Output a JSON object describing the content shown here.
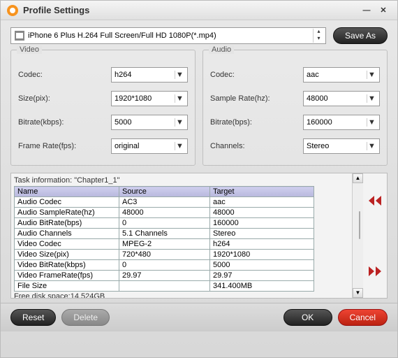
{
  "window": {
    "title": "Profile Settings"
  },
  "profile": {
    "selected": "iPhone 6 Plus H.264 Full Screen/Full HD 1080P(*.mp4)",
    "save_as": "Save As"
  },
  "video": {
    "legend": "Video",
    "codec_label": "Codec:",
    "codec": "h264",
    "size_label": "Size(pix):",
    "size": "1920*1080",
    "bitrate_label": "Bitrate(kbps):",
    "bitrate": "5000",
    "fps_label": "Frame Rate(fps):",
    "fps": "original"
  },
  "audio": {
    "legend": "Audio",
    "codec_label": "Codec:",
    "codec": "aac",
    "rate_label": "Sample Rate(hz):",
    "rate": "48000",
    "bitrate_label": "Bitrate(bps):",
    "bitrate": "160000",
    "channels_label": "Channels:",
    "channels": "Stereo"
  },
  "task": {
    "label": "Task information: \"Chapter1_1\"",
    "headers": {
      "name": "Name",
      "source": "Source",
      "target": "Target"
    },
    "rows": [
      {
        "n": "Audio Codec",
        "s": "AC3",
        "t": "aac"
      },
      {
        "n": "Audio SampleRate(hz)",
        "s": "48000",
        "t": "48000"
      },
      {
        "n": "Audio BitRate(bps)",
        "s": "0",
        "t": "160000"
      },
      {
        "n": "Audio Channels",
        "s": "5.1 Channels",
        "t": "Stereo"
      },
      {
        "n": "Video Codec",
        "s": "MPEG-2",
        "t": "h264"
      },
      {
        "n": "Video Size(pix)",
        "s": "720*480",
        "t": "1920*1080"
      },
      {
        "n": "Video BitRate(kbps)",
        "s": "0",
        "t": "5000"
      },
      {
        "n": "Video FrameRate(fps)",
        "s": "29.97",
        "t": "29.97"
      },
      {
        "n": "File Size",
        "s": "",
        "t": "341.400MB"
      }
    ],
    "free_disk": "Free disk space:14.524GB"
  },
  "footer": {
    "reset": "Reset",
    "delete": "Delete",
    "ok": "OK",
    "cancel": "Cancel"
  }
}
